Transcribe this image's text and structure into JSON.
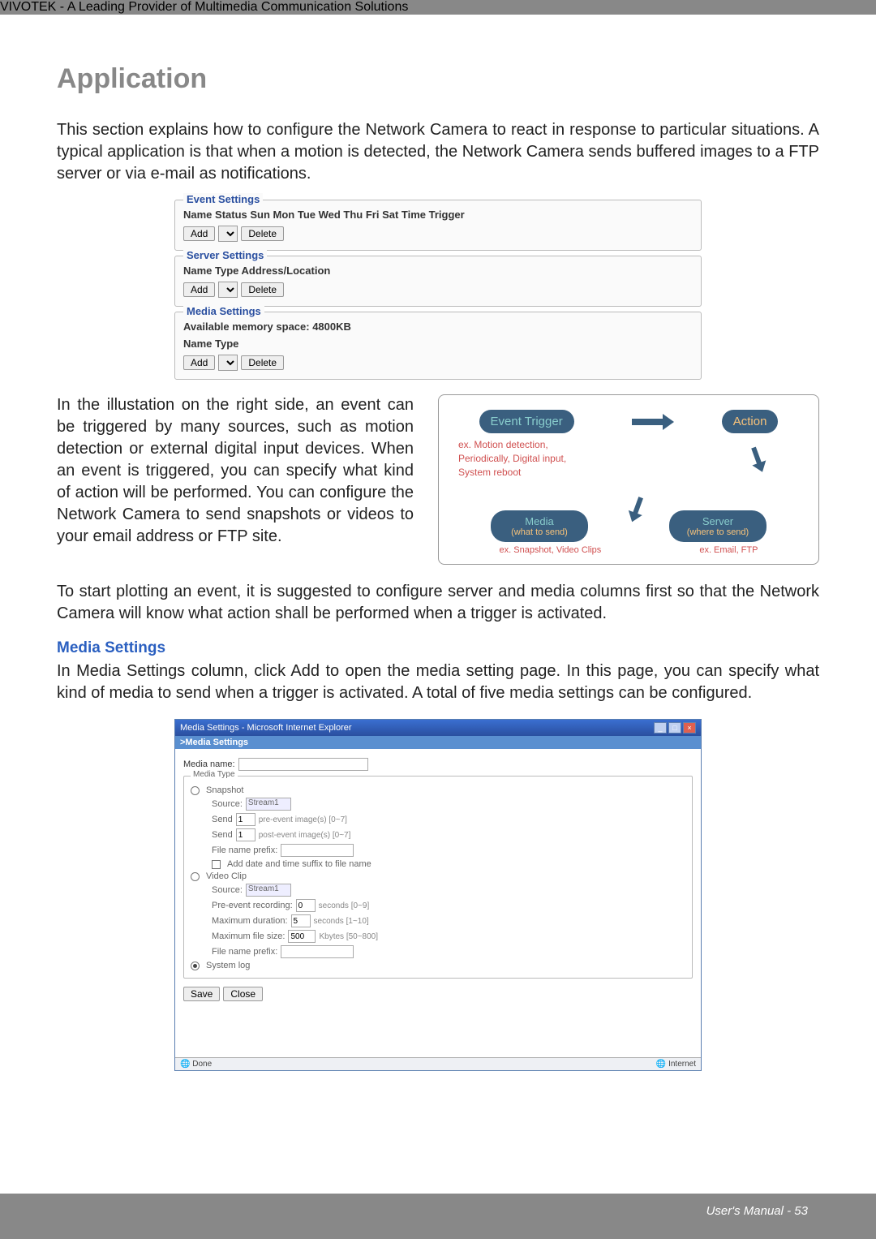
{
  "header": {
    "title": "VIVOTEK - A Leading Provider of Multimedia Communication Solutions"
  },
  "h1": "Application",
  "intro": "This section explains how to configure the Network Camera to react in response to particular situations. A typical application is that when a motion is detected, the Network Camera sends buffered images to a FTP server or via e-mail as notifications.",
  "panels": {
    "event": {
      "legend": "Event Settings",
      "head": "Name Status Sun Mon Tue Wed Thu Fri Sat Time Trigger",
      "add": "Add",
      "delete": "Delete"
    },
    "server": {
      "legend": "Server Settings",
      "head": "Name Type Address/Location",
      "add": "Add",
      "delete": "Delete"
    },
    "media": {
      "legend": "Media Settings",
      "head1": "Available memory space: 4800KB",
      "head2": "Name Type",
      "add": "Add",
      "delete": "Delete"
    }
  },
  "para2": "In the illustation on the right side, an event can be triggered by many sources, such as motion detection or external digital input devices. When an event is triggered, you can specify what kind of action will be performed. You can configure the Network Camera to send snapshots or videos to your email address or FTP site.",
  "diagram": {
    "trigger": "Event Trigger",
    "action": "Action",
    "midlines": "ex. Motion detection,\n  Periodically, Digital input,\n  System reboot",
    "media": "Media",
    "media_sub": "(what to send)",
    "server": "Server",
    "server_sub": "(where to send)",
    "cap_media": "ex. Snapshot, Video Clips",
    "cap_server": "ex. Email, FTP"
  },
  "para3": "To start plotting an event, it is suggested to configure server and media columns first so that the Network Camera will know what action shall be performed when a trigger is activated.",
  "media_h": "Media Settings",
  "para4": "In Media Settings column, click Add to open the media setting page. In this page, you can specify what kind of media to send when a trigger is activated. A total of five media settings can be configured.",
  "ie": {
    "title": "Media Settings - Microsoft Internet Explorer",
    "sub": ">Media Settings",
    "media_name_label": "Media name:",
    "media_name_value": "",
    "media_type_legend": "Media Type",
    "snapshot": {
      "label": "Snapshot",
      "source_label": "Source:",
      "source_value": "Stream1",
      "send1_label": "Send",
      "send1_value": "1",
      "send1_suffix": "pre-event image(s) [0~7]",
      "send2_label": "Send",
      "send2_value": "1",
      "send2_suffix": "post-event image(s) [0~7]",
      "prefix_label": "File name prefix:",
      "prefix_value": "",
      "addtime_label": "Add date and time suffix to file name"
    },
    "video": {
      "label": "Video Clip",
      "source_label": "Source:",
      "source_value": "Stream1",
      "pre_label": "Pre-event recording:",
      "pre_value": "0",
      "pre_suffix": "seconds [0~9]",
      "max_label": "Maximum duration:",
      "max_value": "5",
      "max_suffix": "seconds [1~10]",
      "size_label": "Maximum file size:",
      "size_value": "500",
      "size_suffix": "Kbytes [50~800]",
      "prefix_label": "File name prefix:",
      "prefix_value": ""
    },
    "syslog": {
      "label": "System log"
    },
    "save": "Save",
    "close": "Close",
    "status_done": "Done",
    "status_zone": "Internet"
  },
  "footer": "User's Manual - 53"
}
